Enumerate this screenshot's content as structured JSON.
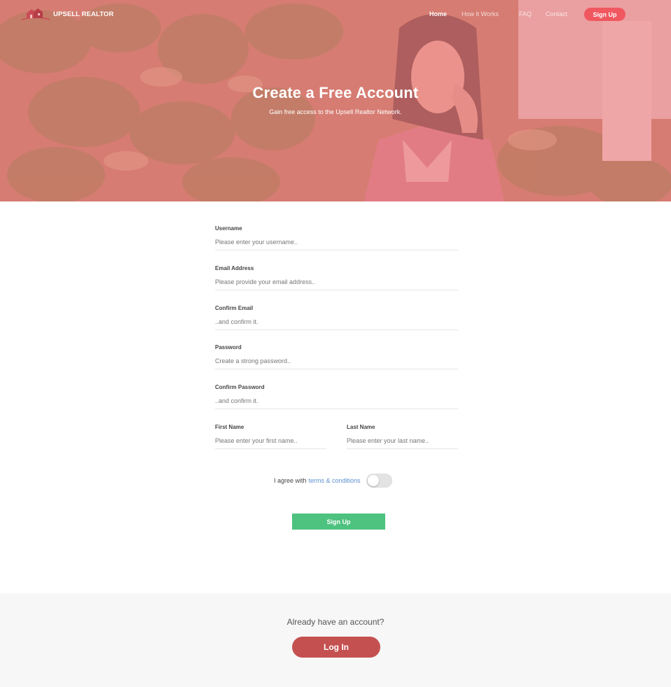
{
  "brand": {
    "name": "UPSELL REALTOR",
    "logo_icon": "house-logo-icon"
  },
  "nav": {
    "items": [
      {
        "label": "Home",
        "active": true
      },
      {
        "label": "How it Works",
        "active": false
      },
      {
        "label": "FAQ",
        "active": false
      },
      {
        "label": "Contact",
        "active": false
      }
    ],
    "signup_label": "Sign Up"
  },
  "hero": {
    "title": "Create a Free Account",
    "subtitle": "Gain free access to the  Upsell Realtor Network."
  },
  "form": {
    "username": {
      "label": "Username",
      "placeholder": "Please enter your username.."
    },
    "email": {
      "label": "Email Address",
      "placeholder": "Please provide your email address.."
    },
    "confirm_email": {
      "label": "Confirm Email",
      "placeholder": "..and confirm it."
    },
    "password": {
      "label": "Password",
      "placeholder": "Create a strong password.."
    },
    "confirm_password": {
      "label": "Confirm Password",
      "placeholder": "..and confirm it."
    },
    "first_name": {
      "label": "First Name",
      "placeholder": "Please enter your first name.."
    },
    "last_name": {
      "label": "Last Name",
      "placeholder": "Please enter your last name.."
    },
    "agree_text": "I agree with",
    "terms_link": "terms & conditions",
    "terms_toggle_on": false,
    "submit_label": "Sign Up"
  },
  "footer": {
    "question": "Already have an account?",
    "login_label": "Log In"
  },
  "colors": {
    "hero_overlay": "#ec7e82",
    "nav_signup": "#f0575f",
    "submit": "#4ec27f",
    "login": "#c55050",
    "link": "#5b8fd0"
  }
}
